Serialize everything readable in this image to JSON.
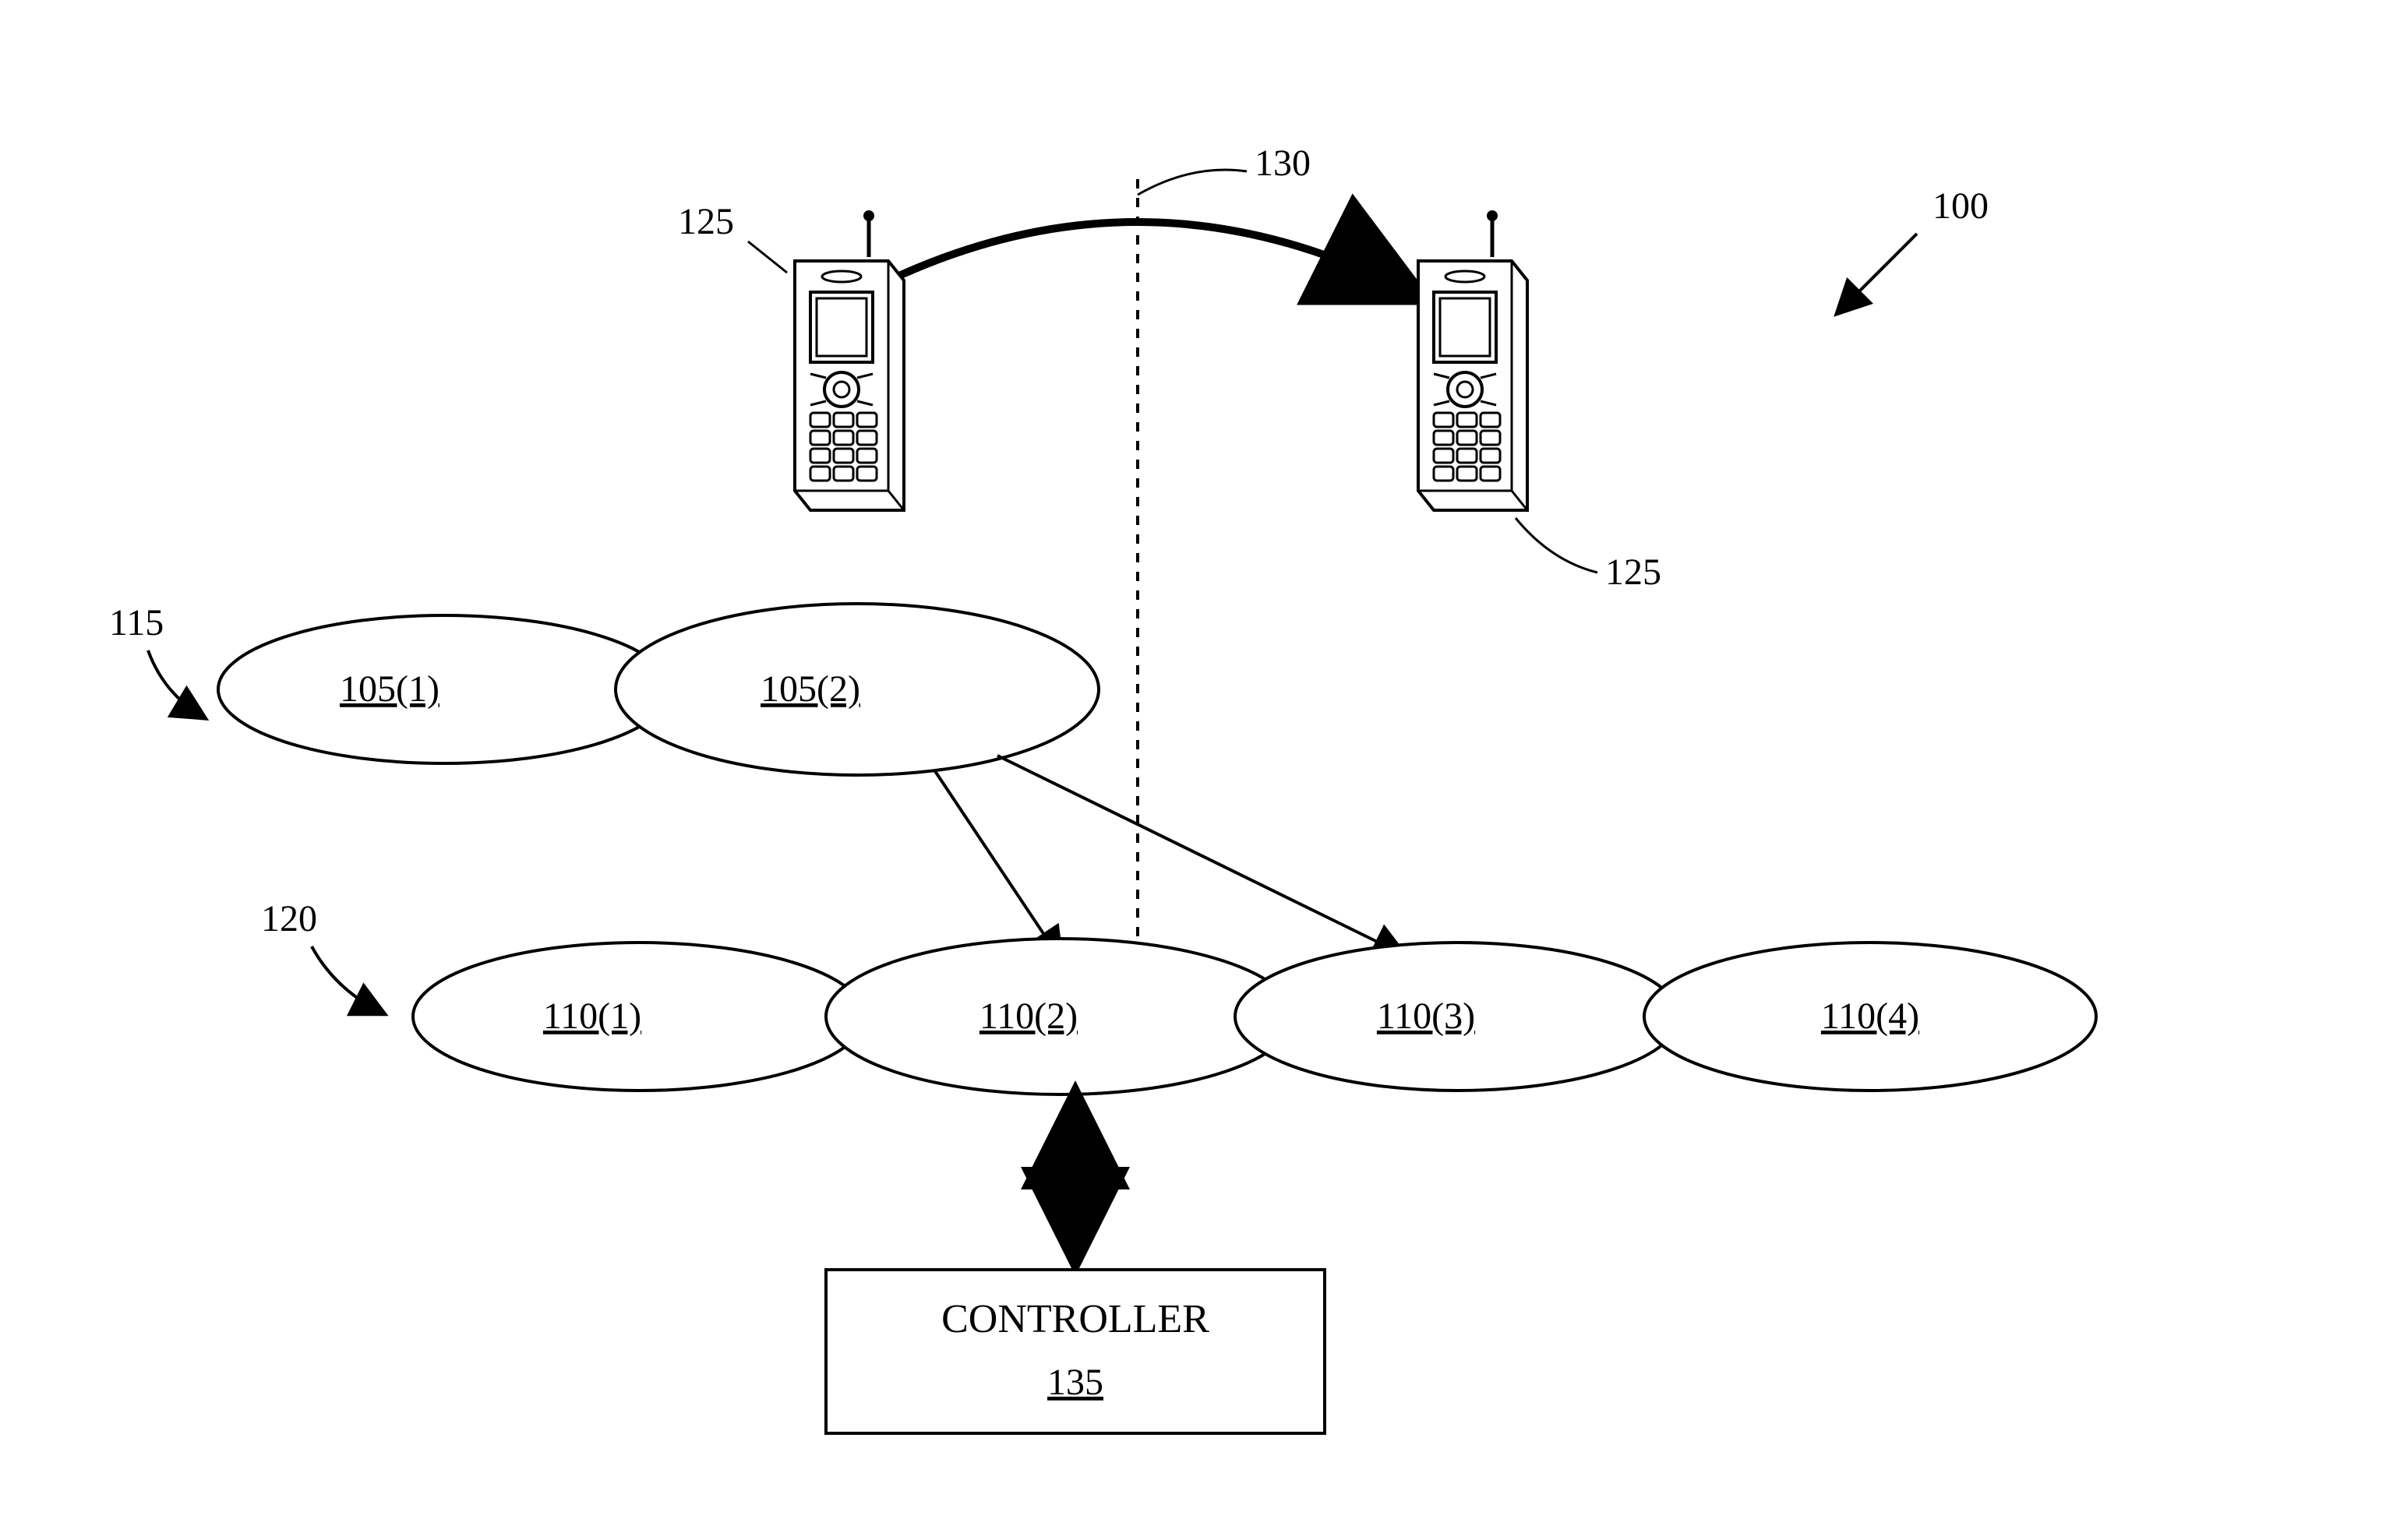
{
  "refs": {
    "system": "100",
    "phone_left": "125",
    "phone_right": "125",
    "handover_arrow": "130",
    "top_row": "115",
    "bottom_row": "120"
  },
  "cells_top": {
    "c1": "105(1)",
    "c2": "105(2)"
  },
  "cells_bottom": {
    "c1": "110(1)",
    "c2": "110(2)",
    "c3": "110(3)",
    "c4": "110(4)"
  },
  "controller": {
    "title": "CONTROLLER",
    "ref": "135"
  }
}
